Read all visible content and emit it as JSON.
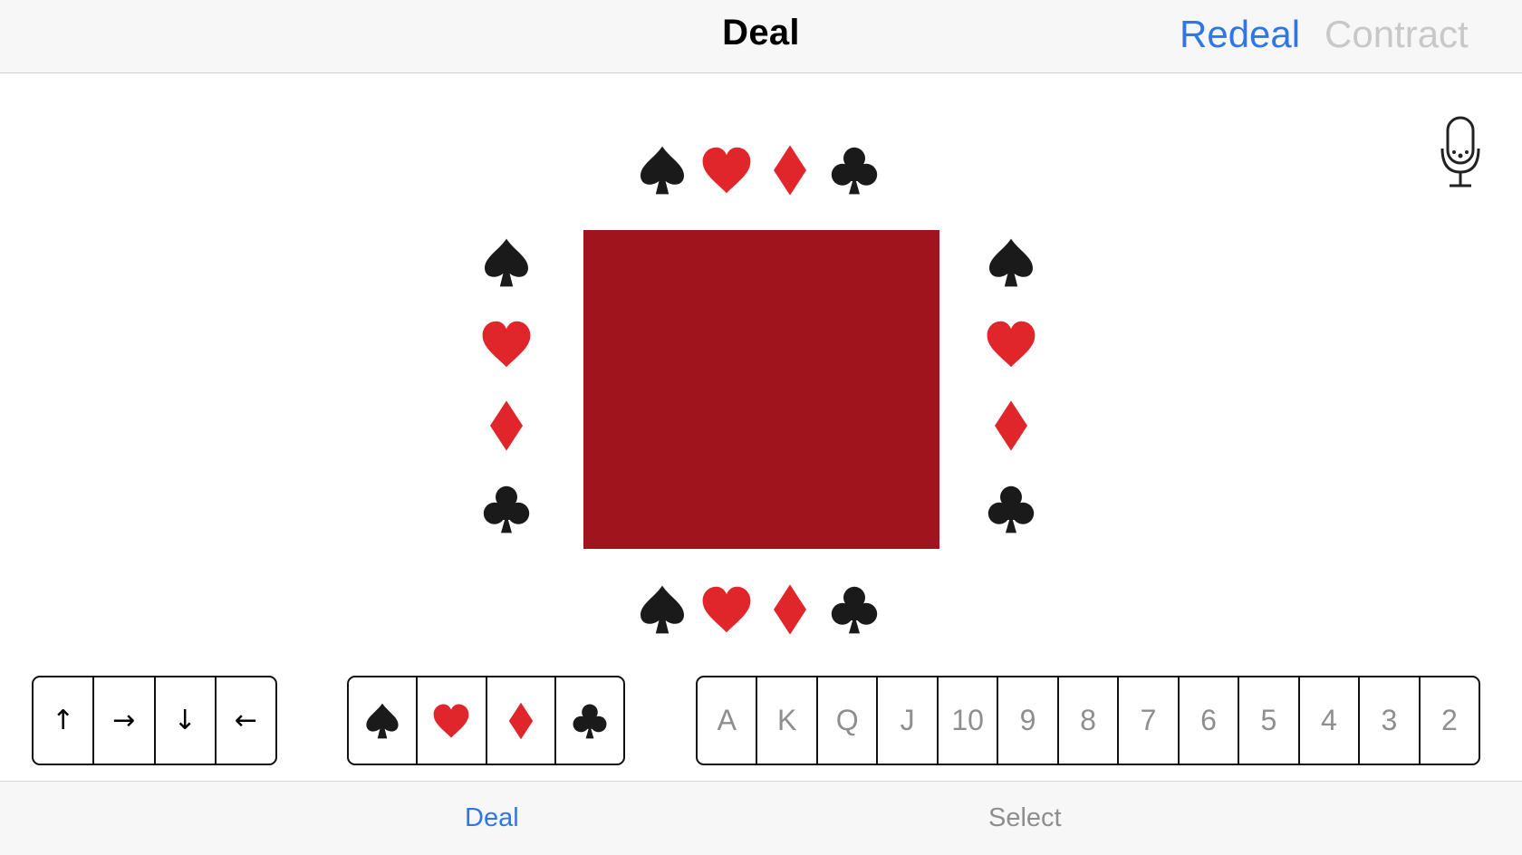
{
  "navbar": {
    "title": "Deal",
    "redeal_label": "Redeal",
    "contract_label": "Contract"
  },
  "icons": {
    "spade": "spade-icon",
    "heart": "heart-icon",
    "diamond": "diamond-icon",
    "club": "club-icon",
    "mic": "microphone-icon"
  },
  "colors": {
    "accent": "#2f76e6",
    "disabled": "#c8c8c8",
    "table": "#a0151d",
    "suit_red": "#e0262a",
    "suit_black": "#1a1a1a"
  },
  "table": {
    "north_suits": [
      "spade",
      "heart",
      "diamond",
      "club"
    ],
    "west_suits": [
      "spade",
      "heart",
      "diamond",
      "club"
    ],
    "east_suits": [
      "spade",
      "heart",
      "diamond",
      "club"
    ],
    "south_suits": [
      "spade",
      "heart",
      "diamond",
      "club"
    ]
  },
  "direction_buttons": [
    "↑",
    "→",
    "↓",
    "←"
  ],
  "suit_buttons": [
    "spade",
    "heart",
    "diamond",
    "club"
  ],
  "rank_buttons": [
    "A",
    "K",
    "Q",
    "J",
    "10",
    "9",
    "8",
    "7",
    "6",
    "5",
    "4",
    "3",
    "2"
  ],
  "tabs": {
    "deal_label": "Deal",
    "select_label": "Select"
  }
}
